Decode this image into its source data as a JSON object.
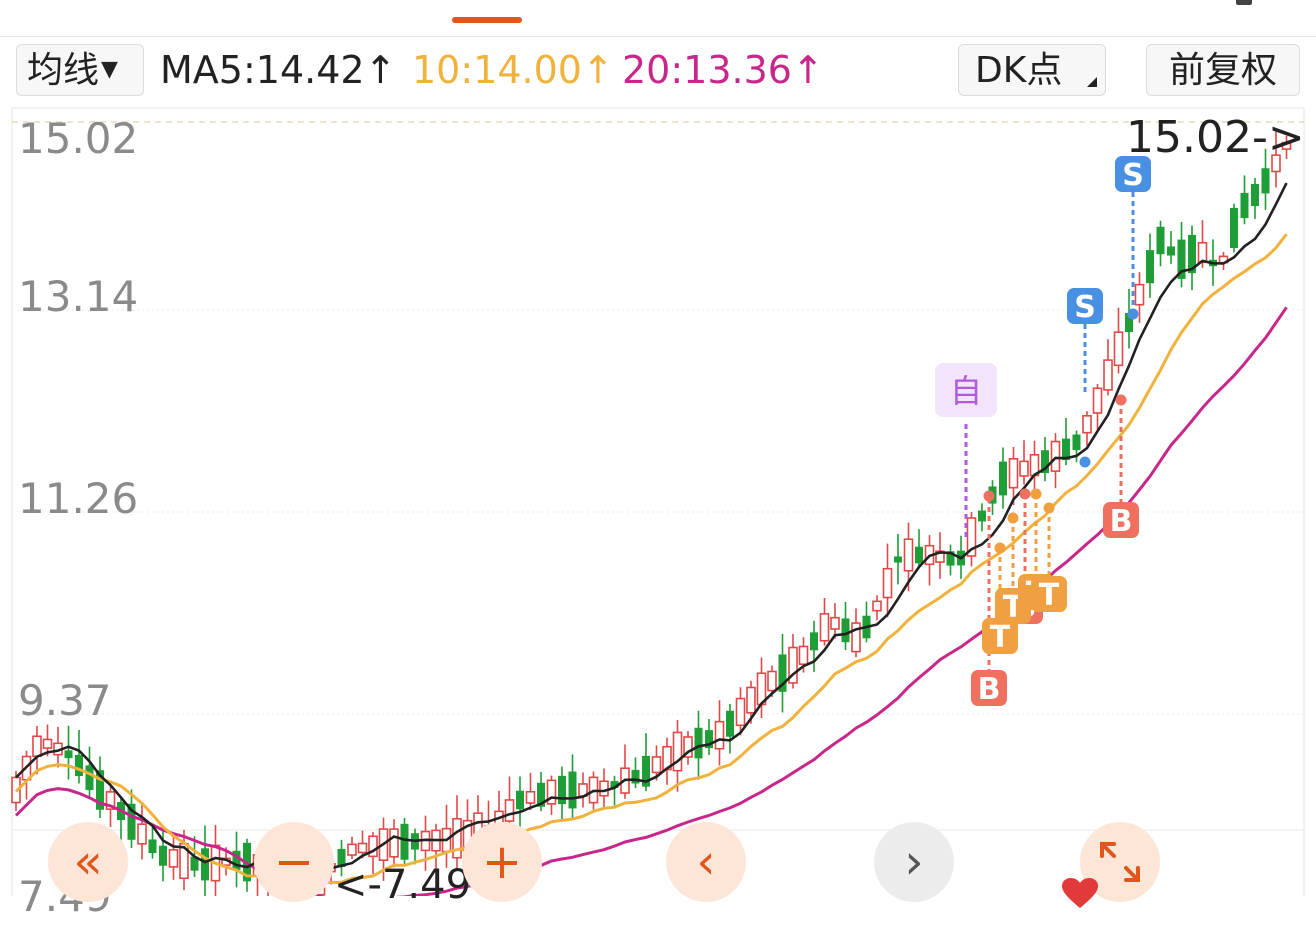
{
  "toolbar": {
    "ma_select_label": "均线",
    "ma5": "MA5:14.42↑",
    "ma10": "10:14.00↑",
    "ma20": "20:13.36↑",
    "dk_button": "DK点",
    "adjust_button": "前复权"
  },
  "colors": {
    "ma5": "#222222",
    "ma10": "#f0b23c",
    "ma20": "#c8268b",
    "up": "#e04848",
    "down": "#1f9d36",
    "buy": "#f07060",
    "sell": "#4a90e2",
    "t_signal": "#f0a040",
    "self_marker": "#b05ae0",
    "accent": "#e2561c"
  },
  "y_axis_labels": [
    "15.02",
    "13.14",
    "11.26",
    "9.37",
    "7.49"
  ],
  "callouts": {
    "high": "15.02->",
    "low": "<-7.49"
  },
  "signals": {
    "buy": "B",
    "sell": "S",
    "t": "T",
    "self": "自"
  },
  "bottom_controls": {
    "rewind_icon": "double-chevron-left-icon",
    "zoom_out_icon": "minus-icon",
    "zoom_in_icon": "plus-icon",
    "prev_icon": "chevron-left-icon",
    "next_icon": "chevron-right-icon",
    "fullscreen_icon": "expand-icon"
  }
}
